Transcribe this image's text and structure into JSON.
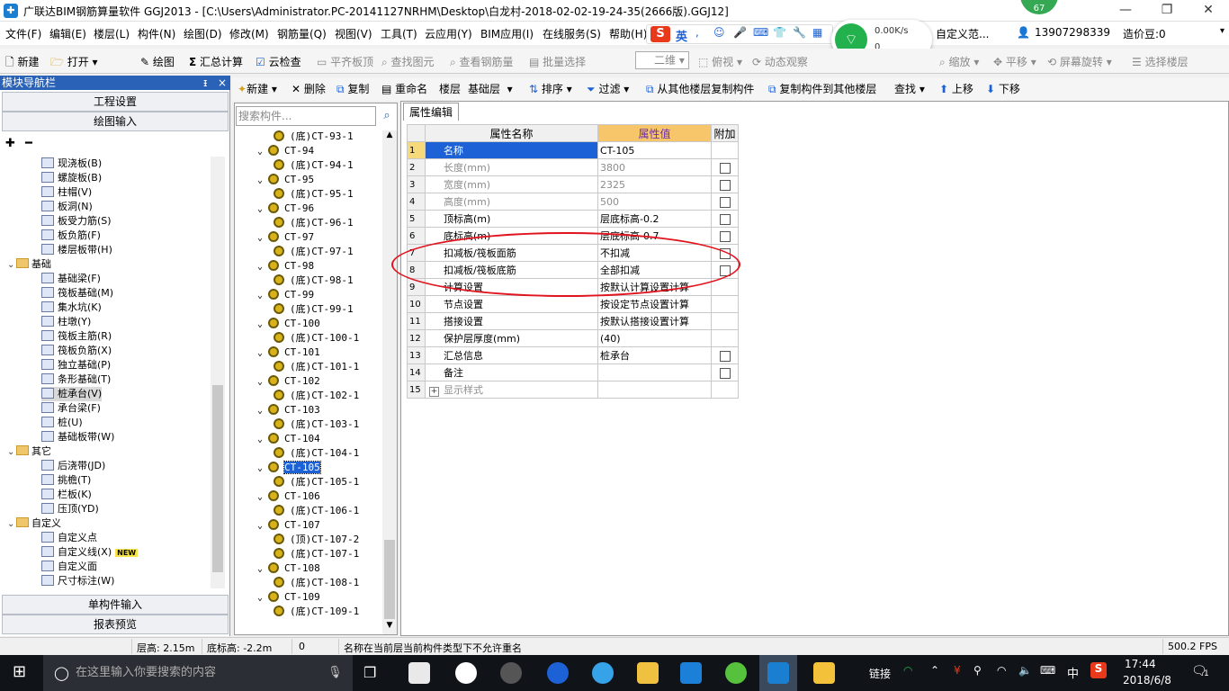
{
  "titlebar": {
    "title": "广联达BIM钢筋算量软件 GGJ2013 - [C:\\Users\\Administrator.PC-20141127NRHM\\Desktop\\白龙村-2018-02-02-19-24-35(2666版).GGJ12]",
    "badge": "67",
    "minimize": "—",
    "restore": "❐",
    "close": "✕"
  },
  "menubar": {
    "items": [
      "文件(F)",
      "编辑(E)",
      "楼层(L)",
      "构件(N)",
      "绘图(D)",
      "修改(M)",
      "钢筋量(Q)",
      "视图(V)",
      "工具(T)",
      "云应用(Y)",
      "BIM应用(I)",
      "在线服务(S)",
      "帮助(H)"
    ],
    "right_custom": "自定义范...",
    "phone": "13907298339",
    "price_beans": "造价豆:0"
  },
  "ime": {
    "logo": "S",
    "lang": "英"
  },
  "network": {
    "speed": "0.00K/s",
    "count": "0"
  },
  "toolbar": {
    "new": "新建",
    "open": "打开",
    "draw": "绘图",
    "sum": "汇总计算",
    "cloud_check": "云检查",
    "align_slab_top": "平齐板顶",
    "find_element": "查找图元",
    "view_rebar": "查看钢筋量",
    "batch_select": "批量选择",
    "view_2d": "二维",
    "top_view": "俯视",
    "dynamic_view": "动态观察",
    "zoom": "缩放",
    "pan": "平移",
    "rotate_screen": "屏幕旋转",
    "select_floor": "选择楼层"
  },
  "leftpanel": {
    "header": "模块导航栏",
    "pin": "ᵻ",
    "close": "×",
    "project_settings": "工程设置",
    "draw_input": "绘图输入",
    "single_input": "单构件输入",
    "report_preview": "报表预览",
    "tree": [
      {
        "label": "现浇板(B)",
        "level": 2
      },
      {
        "label": "螺旋板(B)",
        "level": 2
      },
      {
        "label": "柱帽(V)",
        "level": 2
      },
      {
        "label": "板洞(N)",
        "level": 2
      },
      {
        "label": "板受力筋(S)",
        "level": 2
      },
      {
        "label": "板负筋(F)",
        "level": 2
      },
      {
        "label": "楼层板带(H)",
        "level": 2
      },
      {
        "label": "基础",
        "level": 1
      },
      {
        "label": "基础梁(F)",
        "level": 2
      },
      {
        "label": "筏板基础(M)",
        "level": 2
      },
      {
        "label": "集水坑(K)",
        "level": 2
      },
      {
        "label": "柱墩(Y)",
        "level": 2
      },
      {
        "label": "筏板主筋(R)",
        "level": 2
      },
      {
        "label": "筏板负筋(X)",
        "level": 2
      },
      {
        "label": "独立基础(P)",
        "level": 2
      },
      {
        "label": "条形基础(T)",
        "level": 2
      },
      {
        "label": "桩承台(V)",
        "level": 2,
        "selected": true
      },
      {
        "label": "承台梁(F)",
        "level": 2
      },
      {
        "label": "桩(U)",
        "level": 2
      },
      {
        "label": "基础板带(W)",
        "level": 2
      },
      {
        "label": "其它",
        "level": 1
      },
      {
        "label": "后浇带(JD)",
        "level": 2
      },
      {
        "label": "挑檐(T)",
        "level": 2
      },
      {
        "label": "栏板(K)",
        "level": 2
      },
      {
        "label": "压顶(YD)",
        "level": 2
      },
      {
        "label": "自定义",
        "level": 1
      },
      {
        "label": "自定义点",
        "level": 2
      },
      {
        "label": "自定义线(X)",
        "level": 2,
        "new": "NEW"
      },
      {
        "label": "自定义面",
        "level": 2
      },
      {
        "label": "尺寸标注(W)",
        "level": 2
      }
    ]
  },
  "midpanel": {
    "search_placeholder": "搜索构件...",
    "rows": [
      {
        "label": "(底)CT-93-1",
        "level": 2
      },
      {
        "label": "CT-94",
        "level": 1
      },
      {
        "label": "(底)CT-94-1",
        "level": 2
      },
      {
        "label": "CT-95",
        "level": 1
      },
      {
        "label": "(底)CT-95-1",
        "level": 2
      },
      {
        "label": "CT-96",
        "level": 1
      },
      {
        "label": "(底)CT-96-1",
        "level": 2
      },
      {
        "label": "CT-97",
        "level": 1
      },
      {
        "label": "(底)CT-97-1",
        "level": 2
      },
      {
        "label": "CT-98",
        "level": 1
      },
      {
        "label": "(底)CT-98-1",
        "level": 2
      },
      {
        "label": "CT-99",
        "level": 1
      },
      {
        "label": "(底)CT-99-1",
        "level": 2
      },
      {
        "label": "CT-100",
        "level": 1
      },
      {
        "label": "(底)CT-100-1",
        "level": 2
      },
      {
        "label": "CT-101",
        "level": 1
      },
      {
        "label": "(底)CT-101-1",
        "level": 2
      },
      {
        "label": "CT-102",
        "level": 1
      },
      {
        "label": "(底)CT-102-1",
        "level": 2
      },
      {
        "label": "CT-103",
        "level": 1
      },
      {
        "label": "(底)CT-103-1",
        "level": 2
      },
      {
        "label": "CT-104",
        "level": 1
      },
      {
        "label": "(底)CT-104-1",
        "level": 2
      },
      {
        "label": "CT-105",
        "level": 1,
        "selected": true
      },
      {
        "label": "(底)CT-105-1",
        "level": 2
      },
      {
        "label": "CT-106",
        "level": 1
      },
      {
        "label": "(底)CT-106-1",
        "level": 2
      },
      {
        "label": "CT-107",
        "level": 1
      },
      {
        "label": "(顶)CT-107-2",
        "level": 2
      },
      {
        "label": "(底)CT-107-1",
        "level": 2
      },
      {
        "label": "CT-108",
        "level": 1
      },
      {
        "label": "(底)CT-108-1",
        "level": 2
      },
      {
        "label": "CT-109",
        "level": 1
      },
      {
        "label": "(底)CT-109-1",
        "level": 2
      }
    ]
  },
  "rtoolbar": {
    "new": "新建",
    "delete": "删除",
    "copy": "复制",
    "rename": "重命名",
    "floor_label": "楼层",
    "floor_value": "基础层",
    "sort": "排序",
    "filter": "过滤",
    "copy_from_floor": "从其他楼层复制构件",
    "copy_to_floor": "复制构件到其他楼层",
    "find": "查找",
    "move_up": "上移",
    "move_down": "下移"
  },
  "props": {
    "tab": "属性编辑",
    "headers": {
      "name": "属性名称",
      "value": "属性值",
      "add": "附加"
    },
    "rows": [
      {
        "n": "1",
        "name": "名称",
        "value": "CT-105",
        "check": false,
        "gray": false
      },
      {
        "n": "2",
        "name": "长度(mm)",
        "value": "3800",
        "check": true,
        "gray": true
      },
      {
        "n": "3",
        "name": "宽度(mm)",
        "value": "2325",
        "check": true,
        "gray": true
      },
      {
        "n": "4",
        "name": "高度(mm)",
        "value": "500",
        "check": true,
        "gray": true
      },
      {
        "n": "5",
        "name": "顶标高(m)",
        "value": "层底标高-0.2",
        "check": true,
        "gray": false
      },
      {
        "n": "6",
        "name": "底标高(m)",
        "value": "层底标高-0.7",
        "check": true,
        "gray": false
      },
      {
        "n": "7",
        "name": "扣减板/筏板面筋",
        "value": "不扣减",
        "check": true,
        "gray": false
      },
      {
        "n": "8",
        "name": "扣减板/筏板底筋",
        "value": "全部扣减",
        "check": true,
        "gray": false
      },
      {
        "n": "9",
        "name": "计算设置",
        "value": "按默认计算设置计算",
        "check": false,
        "gray": false
      },
      {
        "n": "10",
        "name": "节点设置",
        "value": "按设定节点设置计算",
        "check": false,
        "gray": false
      },
      {
        "n": "11",
        "name": "搭接设置",
        "value": "按默认搭接设置计算",
        "check": false,
        "gray": false
      },
      {
        "n": "12",
        "name": "保护层厚度(mm)",
        "value": "(40)",
        "check": false,
        "gray": false
      },
      {
        "n": "13",
        "name": "汇总信息",
        "value": "桩承台",
        "check": true,
        "gray": false
      },
      {
        "n": "14",
        "name": "备注",
        "value": "",
        "check": true,
        "gray": false
      },
      {
        "n": "15",
        "name": "显示样式",
        "value": "",
        "check": false,
        "gray": true,
        "expand": "+"
      }
    ]
  },
  "statusbar": {
    "floor_height": "层高: 2.15m",
    "bottom_elev": "底标高: -2.2m",
    "count": "0",
    "message": "名称在当前层当前构件类型下不允许重名",
    "fps": "500.2 FPS"
  },
  "taskbar": {
    "search_placeholder": "在这里输入你要搜索的内容",
    "link": "链接",
    "ime": "中",
    "time": "17:44",
    "date": "2018/6/8",
    "notif": "1"
  },
  "colors": {
    "accent": "#1c62d6",
    "highlight_ellipse": "#e0141e",
    "value_header": "#f7c66a"
  }
}
